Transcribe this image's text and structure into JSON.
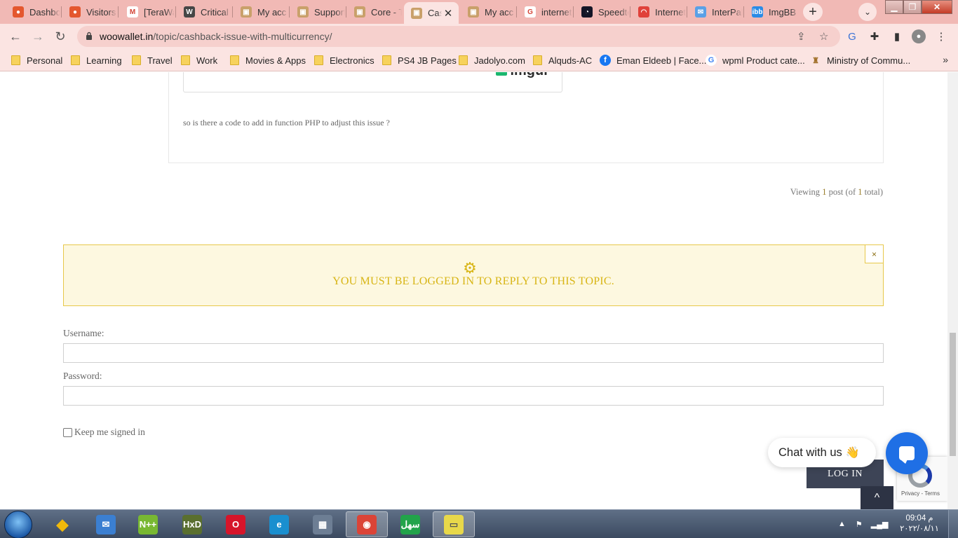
{
  "browser": {
    "tabs": [
      {
        "title": "Dashboard",
        "icon": "hosting-icon"
      },
      {
        "title": "Visitors",
        "icon": "hosting-icon"
      },
      {
        "title": "[TeraWa",
        "icon": "gmail-icon"
      },
      {
        "title": "Critical",
        "icon": "wordpress-icon"
      },
      {
        "title": "My acc",
        "icon": "site-icon"
      },
      {
        "title": "Support",
        "icon": "site-icon"
      },
      {
        "title": "Core - T",
        "icon": "site-icon"
      },
      {
        "title": "Cash",
        "icon": "site-icon"
      },
      {
        "title": "My acc",
        "icon": "site-icon"
      },
      {
        "title": "internet",
        "icon": "google-icon"
      },
      {
        "title": "Speedte",
        "icon": "speedtest-icon"
      },
      {
        "title": "Internet",
        "icon": "gauge-icon"
      },
      {
        "title": "InterPal",
        "icon": "mail-icon"
      },
      {
        "title": "ImgBB",
        "icon": "imgbb-icon"
      }
    ],
    "active_tab_index": 7,
    "url_host": "woowallet.in",
    "url_path": "/topic/cashback-issue-with-multicurrency/",
    "bookmarks": [
      {
        "label": "Personal",
        "type": "folder"
      },
      {
        "label": "Learning",
        "type": "folder"
      },
      {
        "label": "Travel",
        "type": "folder"
      },
      {
        "label": "Work",
        "type": "folder"
      },
      {
        "label": "Movies & Apps",
        "type": "folder"
      },
      {
        "label": "Electronics",
        "type": "folder"
      },
      {
        "label": "PS4 JB Pages",
        "type": "folder"
      },
      {
        "label": "Jadolyo.com",
        "type": "folder"
      },
      {
        "label": "Alquds-AC",
        "type": "folder"
      },
      {
        "label": "Eman Eldeeb | Face...",
        "type": "facebook"
      },
      {
        "label": "wpml Product cate...",
        "type": "google"
      },
      {
        "label": "Ministry of Commu...",
        "type": "site"
      }
    ],
    "bookmarks_more": "»"
  },
  "page": {
    "imgur_logo": "imgur",
    "post_text": "so is there a code to add in function PHP to adjust this issue ?",
    "viewing_prefix": "Viewing ",
    "viewing_n1": "1",
    "viewing_mid": " post (of ",
    "viewing_n2": "1",
    "viewing_suffix": " total)",
    "notice_text": "YOU MUST BE LOGGED IN TO REPLY TO THIS TOPIC.",
    "notice_close": "×",
    "username_label": "Username:",
    "password_label": "Password:",
    "remember_label": "Keep me signed in",
    "login_button": "LOG IN",
    "chat_label": "Chat with us",
    "chat_emoji": "👋",
    "recaptcha_text": "Privacy - Terms",
    "to_top": "^"
  },
  "taskbar": {
    "apps": [
      {
        "name": "binance",
        "label": "◆",
        "color": "#f0b90b",
        "active": false
      },
      {
        "name": "thunderbird",
        "label": "✉",
        "color": "#3b7fd1",
        "active": false
      },
      {
        "name": "notepad-plus-plus",
        "label": "N++",
        "color": "#78b832",
        "active": false
      },
      {
        "name": "hxd",
        "label": "HxD",
        "color": "#5a6f2f",
        "active": false
      },
      {
        "name": "opera",
        "label": "O",
        "color": "#d6152a",
        "active": false
      },
      {
        "name": "edge",
        "label": "e",
        "color": "#1a8fcf",
        "active": false
      },
      {
        "name": "calculator",
        "label": "▦",
        "color": "#6d7e94",
        "active": false
      },
      {
        "name": "chrome",
        "label": "◉",
        "color": "#db4437",
        "active": true
      },
      {
        "name": "sahl",
        "label": "سهل",
        "color": "#22a34a",
        "active": false
      },
      {
        "name": "sticky-notes",
        "label": "▭",
        "color": "#e8d84a",
        "active": true
      }
    ],
    "time": "09:04 م",
    "date": "٢٠٢٢/٠٨/١١"
  }
}
